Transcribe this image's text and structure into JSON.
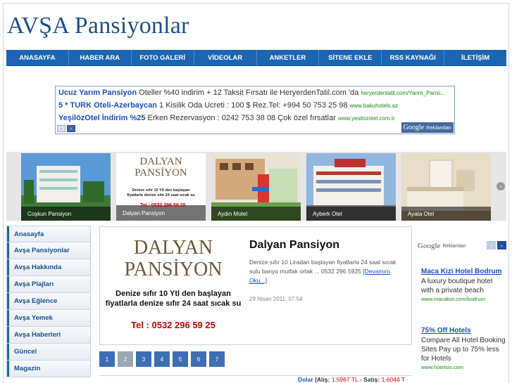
{
  "site": {
    "title": "AVŞA Pansiyonlar"
  },
  "nav": {
    "items": [
      "ANASAYFA",
      "HABER ARA",
      "FOTO GALERİ",
      "VİDEOLAR",
      "ANKETLER",
      "SİTENE EKLE",
      "RSS KAYNAĞI",
      "İLETİŞİM"
    ]
  },
  "top_ads": {
    "lines": [
      {
        "title": "Ucuz Yarım Pansiyon",
        "text": " Oteller %40 indirim + 12 Taksit Fırsatı ile HeryerdenTatil.com 'da ",
        "url": "heryerdentatil.com/Yarim_Pansi..."
      },
      {
        "title": "5 * TURK Oteli-Azerbaycan",
        "text": " 1 Kisilik Oda Ucreti : 100 $ Rez.Tel: +994 50 753 25 98 ",
        "url": "www.bakuhotels.az"
      },
      {
        "title": "YeşilözOtel İndirim %25",
        "text": " Erken Rezervasyon : 0242 753 38 08 Çok özel fırsatlar ",
        "url": "www.yesilozotel.com.tr"
      }
    ],
    "prev_icon": "‹",
    "next_icon": "›",
    "badge_brand": "Google",
    "badge_label": "Reklamları"
  },
  "carousel": {
    "items": [
      {
        "caption": "Coşkun Pansiyon"
      },
      {
        "caption": "Dalyan Pansiyon"
      },
      {
        "caption": "Aydın Motel"
      },
      {
        "caption": "Ayberk Otel"
      },
      {
        "caption": "Ayata Otel"
      }
    ],
    "next_icon": "›",
    "prev_icon": "‹"
  },
  "logo_dalyan": {
    "line1": "DALYAN",
    "line2": "PANSİYON",
    "promo1": "Denize sıfır 10 Ytl den başlayan",
    "promo2": "fiyatlarla denize sıfır 24 saat sıcak su",
    "phone": "Tel : 0532 296 59 25"
  },
  "sidebar": {
    "items": [
      "Anasayfa",
      "Avşa Pansiyonlar",
      "Avşa Hakkında",
      "Avşa Plajları",
      "Avşa Eğlence",
      "Avşa Yemek",
      "Avşa Haberleri",
      "Güncel",
      "Magazin"
    ]
  },
  "feature": {
    "title": "Dalyan Pansiyon",
    "text": "Denize sıfır 10 Liradan başlayan fiyatlarla 24 saat sıcak sulu banyo mutfak ortak ... 0532 296 5925",
    "link": "[Devamını Oku...]",
    "date": "29 Nisan 2011, 07:54"
  },
  "pager": {
    "pages": [
      "1",
      "2",
      "3",
      "4",
      "5",
      "6",
      "7"
    ],
    "active_index": 1
  },
  "currency": {
    "label": "Dolar",
    "buy_label": "(Alış:",
    "buy": "1.5967 TL",
    "sell_label": "- Satış:",
    "sell": "1.6044 T"
  },
  "right_ads": {
    "brand": "Google",
    "label": "Reklamları",
    "prev_icon": "‹",
    "next_icon": "›",
    "ads": [
      {
        "title": "Maca Kizi Hotel Bodrum",
        "body": "A luxury boutique hotel with a private beach",
        "url": "www.macakizi.com/bodrum"
      },
      {
        "title": "75% Off Hotels",
        "body": "Compare All Hotel Booking Sites Pay up to 75% less for Hotels",
        "url": "www.hotelsio.com"
      }
    ]
  },
  "colors": {
    "nav": "#1b65b3",
    "title": "#1d4f8c",
    "link": "#1d4fbf",
    "url": "#1a8a1a"
  }
}
